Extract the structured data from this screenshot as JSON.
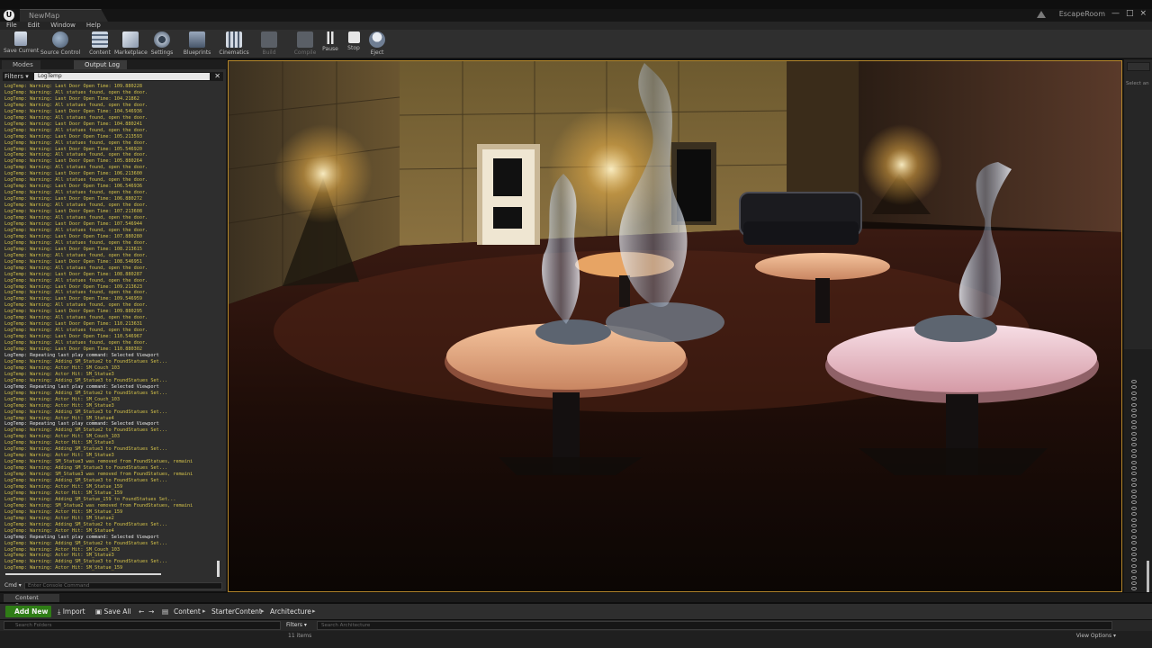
{
  "window": {
    "tab_title": "NewMap",
    "project_name": "EscapeRoom",
    "controls": [
      "—",
      "□",
      "×"
    ]
  },
  "menu": [
    "File",
    "Edit",
    "Window",
    "Help"
  ],
  "toolbar": {
    "buttons": [
      {
        "label": "Save Current",
        "icon": "save-icon"
      },
      {
        "label": "Source Control",
        "icon": "source-control-icon"
      },
      {
        "label": "Content",
        "icon": "content-icon"
      },
      {
        "label": "Marketplace",
        "icon": "marketplace-icon"
      },
      {
        "label": "Settings",
        "icon": "settings-icon"
      },
      {
        "label": "Blueprints",
        "icon": "blueprints-icon"
      },
      {
        "label": "Cinematics",
        "icon": "cinematics-icon"
      },
      {
        "label": "Build",
        "icon": "build-icon",
        "disabled": true
      },
      {
        "label": "Compile",
        "icon": "compile-icon",
        "disabled": true
      },
      {
        "label": "Pause",
        "icon": "pause-icon"
      },
      {
        "label": "Stop",
        "icon": "stop-icon"
      },
      {
        "label": "Eject",
        "icon": "eject-icon"
      }
    ]
  },
  "left_tabs": [
    "Modes",
    "Output Log"
  ],
  "output_log": {
    "filters_label": "Filters ▾",
    "filter_text": "LogTemp",
    "close_glyph": "✕",
    "lines": [
      {
        "t": "LogTemp: Warning: Last Door Open Time:  109.880228",
        "w": true
      },
      {
        "t": "LogTemp: Warning: All statues found, open the door.",
        "w": true
      },
      {
        "t": "LogTemp: Warning: Last Door Open Time:  104.21862",
        "w": true
      },
      {
        "t": "LogTemp: Warning: All statues found, open the door.",
        "w": true
      },
      {
        "t": "LogTemp: Warning: Last Door Open Time:  104.546936",
        "w": true
      },
      {
        "t": "LogTemp: Warning: All statues found, open the door.",
        "w": true
      },
      {
        "t": "LogTemp: Warning: Last Door Open Time:  104.880241",
        "w": true
      },
      {
        "t": "LogTemp: Warning: All statues found, open the door.",
        "w": true
      },
      {
        "t": "LogTemp: Warning: Last Door Open Time:  105.213593",
        "w": true
      },
      {
        "t": "LogTemp: Warning: All statues found, open the door.",
        "w": true
      },
      {
        "t": "LogTemp: Warning: Last Door Open Time:  105.546920",
        "w": true
      },
      {
        "t": "LogTemp: Warning: All statues found, open the door.",
        "w": true
      },
      {
        "t": "LogTemp: Warning: Last Door Open Time:  105.880264",
        "w": true
      },
      {
        "t": "LogTemp: Warning: All statues found, open the door.",
        "w": true
      },
      {
        "t": "LogTemp: Warning: Last Door Open Time:  106.213600",
        "w": true
      },
      {
        "t": "LogTemp: Warning: All statues found, open the door.",
        "w": true
      },
      {
        "t": "LogTemp: Warning: Last Door Open Time:  106.546936",
        "w": true
      },
      {
        "t": "LogTemp: Warning: All statues found, open the door.",
        "w": true
      },
      {
        "t": "LogTemp: Warning: Last Door Open Time:  106.880272",
        "w": true
      },
      {
        "t": "LogTemp: Warning: All statues found, open the door.",
        "w": true
      },
      {
        "t": "LogTemp: Warning: Last Door Open Time:  107.213608",
        "w": true
      },
      {
        "t": "LogTemp: Warning: All statues found, open the door.",
        "w": true
      },
      {
        "t": "LogTemp: Warning: Last Door Open Time:  107.546944",
        "w": true
      },
      {
        "t": "LogTemp: Warning: All statues found, open the door.",
        "w": true
      },
      {
        "t": "LogTemp: Warning: Last Door Open Time:  107.880280",
        "w": true
      },
      {
        "t": "LogTemp: Warning: All statues found, open the door.",
        "w": true
      },
      {
        "t": "LogTemp: Warning: Last Door Open Time:  108.213615",
        "w": true
      },
      {
        "t": "LogTemp: Warning: All statues found, open the door.",
        "w": true
      },
      {
        "t": "LogTemp: Warning: Last Door Open Time:  108.546951",
        "w": true
      },
      {
        "t": "LogTemp: Warning: All statues found, open the door.",
        "w": true
      },
      {
        "t": "LogTemp: Warning: Last Door Open Time:  108.880287",
        "w": true
      },
      {
        "t": "LogTemp: Warning: All statues found, open the door.",
        "w": true
      },
      {
        "t": "LogTemp: Warning: Last Door Open Time:  109.213623",
        "w": true
      },
      {
        "t": "LogTemp: Warning: All statues found, open the door.",
        "w": true
      },
      {
        "t": "LogTemp: Warning: Last Door Open Time:  109.546959",
        "w": true
      },
      {
        "t": "LogTemp: Warning: All statues found, open the door.",
        "w": true
      },
      {
        "t": "LogTemp: Warning: Last Door Open Time:  109.880295",
        "w": true
      },
      {
        "t": "LogTemp: Warning: All statues found, open the door.",
        "w": true
      },
      {
        "t": "LogTemp: Warning: Last Door Open Time:  110.213631",
        "w": true
      },
      {
        "t": "LogTemp: Warning: All statues found, open the door.",
        "w": true
      },
      {
        "t": "LogTemp: Warning: Last Door Open Time:  110.546967",
        "w": true
      },
      {
        "t": "LogTemp: Warning: All statues found, open the door.",
        "w": true
      },
      {
        "t": "LogTemp: Warning: Last Door Open Time:  110.880302",
        "w": true
      },
      {
        "t": "LogTemp: Repeating last play command: Selected Viewport",
        "w": false
      },
      {
        "t": "LogTemp: Warning: Adding SM_Statue2 to FoundStatues Set...",
        "w": true
      },
      {
        "t": "LogTemp: Warning: Actor Hit: SM_Couch_103",
        "w": true
      },
      {
        "t": "LogTemp: Warning: Actor Hit: SM_Statue3",
        "w": true
      },
      {
        "t": "LogTemp: Warning: Adding SM_Statue3 to FoundStatues Set...",
        "w": true
      },
      {
        "t": "LogTemp: Repeating last play command: Selected Viewport",
        "w": false
      },
      {
        "t": "LogTemp: Warning: Adding SM_Statue2 to FoundStatues Set...",
        "w": true
      },
      {
        "t": "LogTemp: Warning: Actor Hit: SM_Couch_103",
        "w": true
      },
      {
        "t": "LogTemp: Warning: Actor Hit: SM_Statue3",
        "w": true
      },
      {
        "t": "LogTemp: Warning: Adding SM_Statue3 to FoundStatues Set...",
        "w": true
      },
      {
        "t": "LogTemp: Warning: Actor Hit: SM_Statue4",
        "w": true
      },
      {
        "t": "LogTemp: Repeating last play command: Selected Viewport",
        "w": false
      },
      {
        "t": "LogTemp: Warning: Adding SM_Statue2 to FoundStatues Set...",
        "w": true
      },
      {
        "t": "LogTemp: Warning: Actor Hit: SM_Couch_103",
        "w": true
      },
      {
        "t": "LogTemp: Warning: Actor Hit: SM_Statue3",
        "w": true
      },
      {
        "t": "LogTemp: Warning: Adding SM_Statue3 to FoundStatues Set...",
        "w": true
      },
      {
        "t": "LogTemp: Warning: Actor Hit: SM_Statue3",
        "w": true
      },
      {
        "t": "LogTemp: Warning: SM_Statue3 was removed from FoundStatues, remaini",
        "w": true
      },
      {
        "t": "LogTemp: Warning: Adding SM_Statue3 to FoundStatues Set...",
        "w": true
      },
      {
        "t": "LogTemp: Warning: SM_Statue3 was removed from FoundStatues, remaini",
        "w": true
      },
      {
        "t": "LogTemp: Warning: Adding SM_Statue3 to FoundStatues Set...",
        "w": true
      },
      {
        "t": "LogTemp: Warning: Actor Hit: SM_Statue_159",
        "w": true
      },
      {
        "t": "LogTemp: Warning: Actor Hit: SM_Statue_159",
        "w": true
      },
      {
        "t": "LogTemp: Warning: Adding SM_Statue_159 to FoundStatues Set...",
        "w": true
      },
      {
        "t": "LogTemp: Warning: SM_Statue2 was removed from FoundStatues, remaini",
        "w": true
      },
      {
        "t": "LogTemp: Warning: Actor Hit: SM_Statue_159",
        "w": true
      },
      {
        "t": "LogTemp: Warning: Actor Hit: SM_Statue2",
        "w": true
      },
      {
        "t": "LogTemp: Warning: Adding SM_Statue2 to FoundStatues Set...",
        "w": true
      },
      {
        "t": "LogTemp: Warning: Actor Hit: SM_Statue4",
        "w": true
      },
      {
        "t": "LogTemp: Repeating last play command: Selected Viewport",
        "w": false
      },
      {
        "t": "LogTemp: Warning: Adding SM_Statue2 to FoundStatues Set...",
        "w": true
      },
      {
        "t": "LogTemp: Warning: Actor Hit: SM_Couch_103",
        "w": true
      },
      {
        "t": "LogTemp: Warning: Actor Hit: SM_Statue3",
        "w": true
      },
      {
        "t": "LogTemp: Warning: Adding SM_Statue3 to FoundStatues Set...",
        "w": true
      },
      {
        "t": "LogTemp: Warning: Actor Hit: SM_Statue_159",
        "w": true
      }
    ],
    "cmd_label": "Cmd ▾",
    "cmd_placeholder": "Enter Console Command"
  },
  "right_panel": {
    "hint": "Select an"
  },
  "content_browser": {
    "tab_label": "Content Browser",
    "add_new": "Add New ▾",
    "import": "Import",
    "save_all": "Save All",
    "breadcrumbs": [
      "Content",
      "StarterContent",
      "Architecture"
    ],
    "search_folders_placeholder": "Search Folders",
    "filters_label": "Filters ▾",
    "search_assets_placeholder": "Search Architecture",
    "items_count": "11 items",
    "view_options": "View Options ▾"
  },
  "colors": {
    "accent_green": "#2f7d16",
    "viewport_border": "#b7892c",
    "log_warning": "#d4c24a"
  }
}
